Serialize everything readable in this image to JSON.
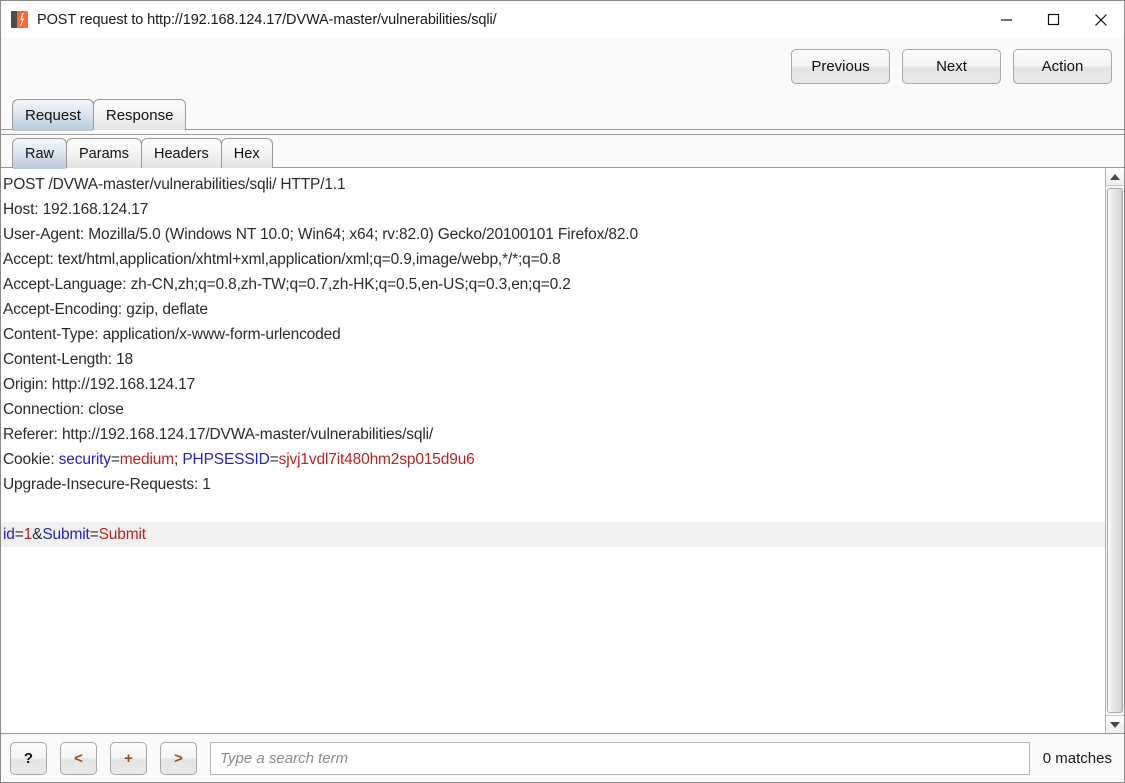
{
  "window": {
    "title": "POST request to http://192.168.124.17/DVWA-master/vulnerabilities/sqli/",
    "icon": "burp-suite-logo",
    "controls": {
      "minimize": "minimize-icon",
      "maximize": "maximize-icon",
      "close": "close-icon"
    }
  },
  "toolbar": {
    "previous_label": "Previous",
    "next_label": "Next",
    "action_label": "Action"
  },
  "outer_tabs": {
    "selected": "Request",
    "items": [
      {
        "label": "Request",
        "selected": true
      },
      {
        "label": "Response",
        "selected": false
      }
    ]
  },
  "inner_tabs": {
    "selected": "Raw",
    "items": [
      {
        "label": "Raw",
        "selected": true
      },
      {
        "label": "Params",
        "selected": false
      },
      {
        "label": "Headers",
        "selected": false
      },
      {
        "label": "Hex",
        "selected": false
      }
    ]
  },
  "editor": {
    "lines": [
      {
        "text": "POST /DVWA-master/vulnerabilities/sqli/ HTTP/1.1"
      },
      {
        "text": "Host: 192.168.124.17"
      },
      {
        "text": "User-Agent: Mozilla/5.0 (Windows NT 10.0; Win64; x64; rv:82.0) Gecko/20100101 Firefox/82.0"
      },
      {
        "text": "Accept: text/html,application/xhtml+xml,application/xml;q=0.9,image/webp,*/*;q=0.8"
      },
      {
        "text": "Accept-Language: zh-CN,zh;q=0.8,zh-TW;q=0.7,zh-HK;q=0.5,en-US;q=0.3,en;q=0.2"
      },
      {
        "text": "Accept-Encoding: gzip, deflate"
      },
      {
        "text": "Content-Type: application/x-www-form-urlencoded"
      },
      {
        "text": "Content-Length: 18"
      },
      {
        "text": "Origin: http://192.168.124.17"
      },
      {
        "text": "Connection: close"
      },
      {
        "text": "Referer: http://192.168.124.17/DVWA-master/vulnerabilities/sqli/"
      },
      {
        "segments": [
          {
            "text": "Cookie: ",
            "kind": "plain"
          },
          {
            "text": "security",
            "kind": "name"
          },
          {
            "text": "=",
            "kind": "plain"
          },
          {
            "text": "medium",
            "kind": "value"
          },
          {
            "text": "; ",
            "kind": "plain"
          },
          {
            "text": "PHPSESSID",
            "kind": "name"
          },
          {
            "text": "=",
            "kind": "plain"
          },
          {
            "text": "sjvj1vdl7it480hm2sp015d9u6",
            "kind": "value"
          }
        ]
      },
      {
        "text": "Upgrade-Insecure-Requests: 1"
      },
      {
        "text": ""
      },
      {
        "highlight": true,
        "segments": [
          {
            "text": "id",
            "kind": "name"
          },
          {
            "text": "=",
            "kind": "plain"
          },
          {
            "text": "1",
            "kind": "value"
          },
          {
            "text": "&",
            "kind": "plain"
          },
          {
            "text": "Submit",
            "kind": "name"
          },
          {
            "text": "=",
            "kind": "plain"
          },
          {
            "text": "Submit",
            "kind": "value"
          }
        ]
      }
    ]
  },
  "scrollbar": {
    "up_arrow": "scroll-up-icon",
    "down_arrow": "scroll-down-icon"
  },
  "searchbar": {
    "help_label": "?",
    "prev_label": "<",
    "plus_label": "+",
    "next_label": ">",
    "placeholder": "Type a search term",
    "value": "",
    "matches_label": "0 matches"
  },
  "colors": {
    "accent_orange": "#ff6633",
    "param_name": "#2222cc",
    "param_value": "#bb2222",
    "tab_selected": "#b9c9d9"
  }
}
